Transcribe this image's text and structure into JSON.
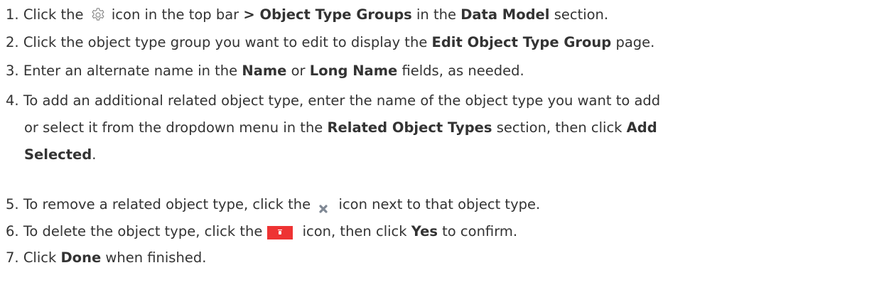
{
  "steps": [
    {
      "num": "1.",
      "a": "Click the",
      "b": "icon in the top bar",
      "c": "> Object Type Groups",
      "d": "in the",
      "e": "Data Model",
      "f": "section."
    },
    {
      "num": "2.",
      "a": "Click the object type group you want to edit to display the",
      "b": "Edit Object Type Group",
      "c": "page."
    },
    {
      "num": "3.",
      "a": "Enter an alternate name in the",
      "b": "Name",
      "c": "or",
      "d": "Long Name",
      "e": "fields, as needed."
    },
    {
      "num": "4.",
      "a": "To add an additional related object type, enter the name of the object type you want to add",
      "b": "or select it from the dropdown menu in the",
      "c": "Related Object Types",
      "d": "section, then click",
      "e": "Add",
      "f": "Selected",
      "g": "."
    },
    {
      "num": "5.",
      "a": "To remove a related object type, click the",
      "b": "icon next to that object type."
    },
    {
      "num": "6.",
      "a": "To delete the object type, click the",
      "b": "icon, then click",
      "c": "Yes",
      "d": "to confirm."
    },
    {
      "num": "7.",
      "a": "Click",
      "b": "Done",
      "c": "when finished."
    }
  ],
  "icons": {
    "settings": "gear-icon",
    "remove": "close-icon",
    "delete": "trash-icon",
    "delete_color": "#ee3333",
    "remove_color": "#7f8894"
  }
}
